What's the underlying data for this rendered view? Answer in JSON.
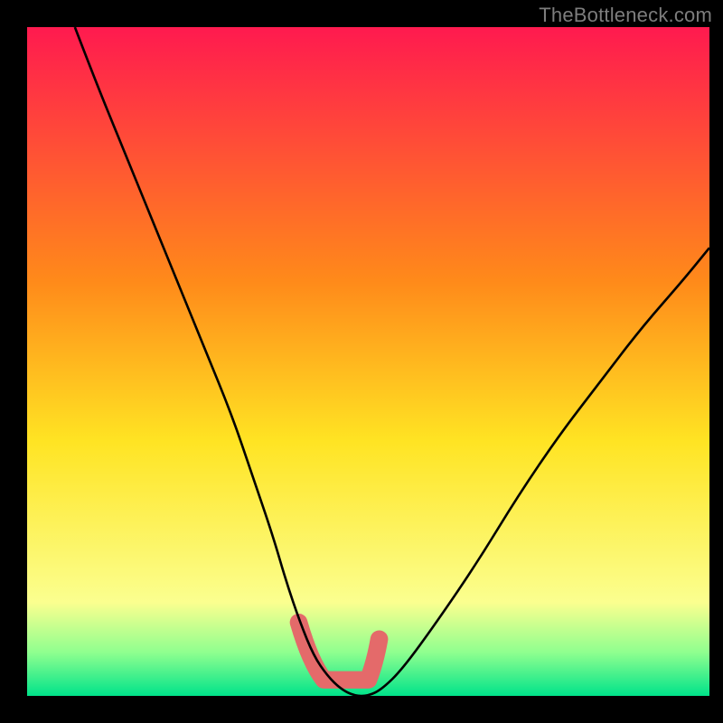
{
  "watermark": "TheBottleneck.com",
  "colors": {
    "bg": "#000000",
    "gradient_top": "#ff1a4f",
    "gradient_mid1": "#ff8a1a",
    "gradient_mid2": "#ffe423",
    "gradient_low": "#fbff8f",
    "gradient_bottom1": "#8fff8f",
    "gradient_bottom2": "#00e38a",
    "curve": "#000000",
    "marker": "#e46a6a"
  },
  "chart_data": {
    "type": "line",
    "title": "",
    "xlabel": "",
    "ylabel": "",
    "xlim": [
      0,
      100
    ],
    "ylim": [
      0,
      100
    ],
    "grid": false,
    "legend": false,
    "annotations": [],
    "series": [
      {
        "name": "bottleneck-curve",
        "x": [
          7,
          10,
          14,
          18,
          22,
          26,
          30,
          33,
          36,
          38,
          40,
          42,
          44,
          46,
          48,
          50,
          52,
          55,
          60,
          66,
          72,
          78,
          84,
          90,
          96,
          100
        ],
        "y": [
          100,
          92,
          82,
          72,
          62,
          52,
          42,
          33,
          24,
          17,
          11,
          6,
          3,
          1,
          0,
          0,
          1,
          4,
          11,
          20,
          30,
          39,
          47,
          55,
          62,
          67
        ]
      }
    ],
    "markers": {
      "name": "highlight-band",
      "x_range": [
        39.5,
        51.5
      ],
      "y_range": [
        0,
        12
      ],
      "shape": "U"
    }
  }
}
